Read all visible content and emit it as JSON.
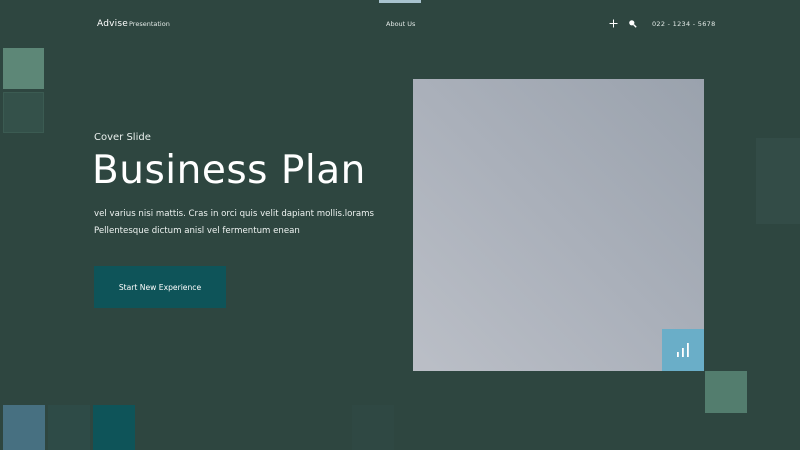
{
  "header": {
    "brand": "Advise",
    "brand_sub": "Presentation",
    "nav_link": "About Us",
    "phone": "022 - 1234 - 5678",
    "icons": [
      "plus-icon",
      "search-icon"
    ]
  },
  "hero": {
    "label": "Cover Slide",
    "title": "Business Plan",
    "body_line_1": "vel varius nisi mattis. Cras in orci quis velit dapiant  mollis.lorams",
    "body_line_2": "Pellentesque dictum anisl vel fermentum enean",
    "cta_label": "Start New Experience"
  },
  "image": {
    "badge_icon": "bar-chart-icon"
  },
  "colors": {
    "background": "#2e4640",
    "accent_teal": "#0e5459",
    "badge_blue": "#6aaec8",
    "sage": "#5d8777"
  }
}
